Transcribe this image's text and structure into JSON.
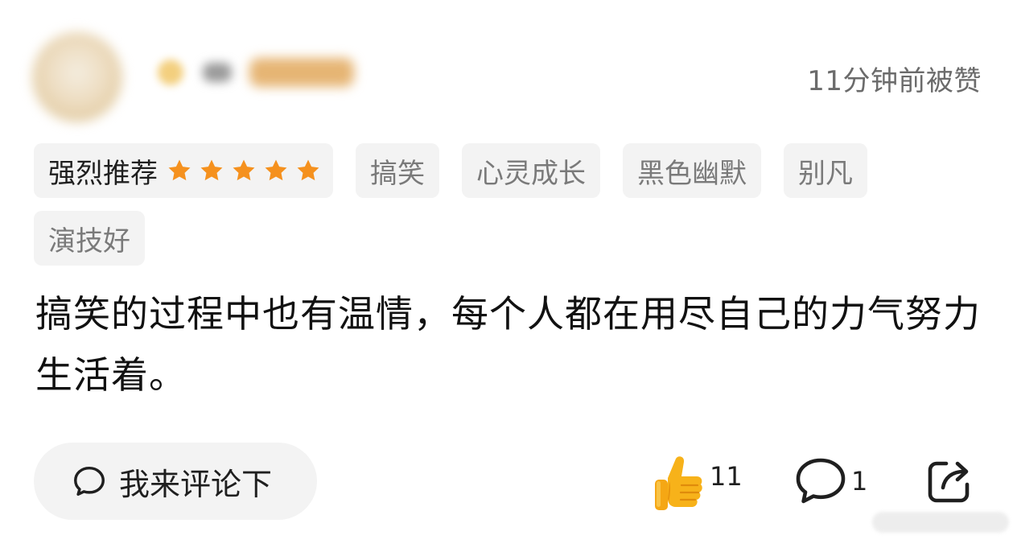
{
  "header": {
    "time_text": "11分钟前被赞"
  },
  "tags": {
    "rating_label": "强烈推荐",
    "rating_stars": 5,
    "rating_star_color": "#f5911e",
    "items": [
      "搞笑",
      "心灵成长",
      "黑色幽默",
      "别凡",
      "演技好"
    ]
  },
  "comment": {
    "text": "搞笑的过程中也有温情，每个人都在用尽自己的力气努力生活着。"
  },
  "footer": {
    "comment_button_label": "我来评论下",
    "like_count": "11",
    "reply_count": "1"
  },
  "icons": {
    "comment": "speech-bubble-icon",
    "like": "thumbs-up-icon",
    "reply": "reply-bubble-icon",
    "share": "share-icon"
  }
}
